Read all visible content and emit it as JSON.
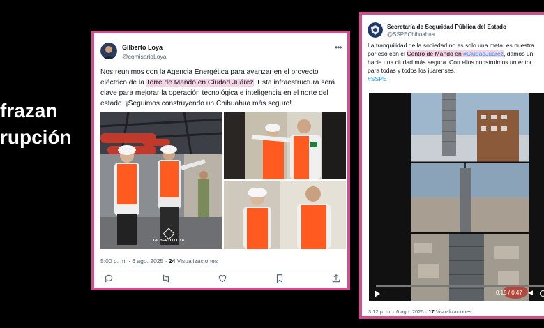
{
  "headline": {
    "line1": "frazan",
    "line2": "rupción"
  },
  "tweet1": {
    "author_name": "Gilberto Loya",
    "author_handle": "@comisarioLoya",
    "text_before": "Nos reunimos con la Agencia Energética para avanzar en el proyecto eléctrico de la ",
    "text_highlight": "Torre de Mando en Ciudad Juárez",
    "text_after": ". Esta infraestructura será clave para mejorar la operación tecnológica e inteligencia en el norte del estado. ¡Seguimos construyendo un Chihuahua más seguro!",
    "watermark": "GILBERTO LOYA",
    "time": "5:00 p. m. · 6 ago. 2025 · ",
    "views_count": "24",
    "views_label": " Visualizaciones",
    "actions": [
      "reply-icon",
      "retweet-icon",
      "like-icon",
      "bookmark-icon",
      "share-icon"
    ]
  },
  "tweet2": {
    "author_name": "Secretaría de Seguridad Pública del Estado",
    "author_handle": "@SSPEChihuahua",
    "text_a": "La tranquilidad de la sociedad no es solo una meta: es nuestra",
    "text_b": "por eso con el ",
    "text_highlight": "Centro de Mando en",
    "text_hashtag1": "#CiudadJuárez",
    "text_c": ", damos un",
    "text_d": "hacia una ciudad más segura. Con ellos construimos un entor",
    "text_e": "para todas y todos los juarenses.",
    "hashtag2": "#SSPE",
    "video_time": "0:15 / 0:47",
    "time": "3:12 p. m. · 6 ago. 2025 · ",
    "views_count": "17",
    "views_label": " Visualizaciones"
  },
  "colors": {
    "accent_border": "#d24d8f",
    "highlight": "#f6d3e6",
    "link": "#1d9bf0",
    "vest": "#ff5a1f"
  }
}
